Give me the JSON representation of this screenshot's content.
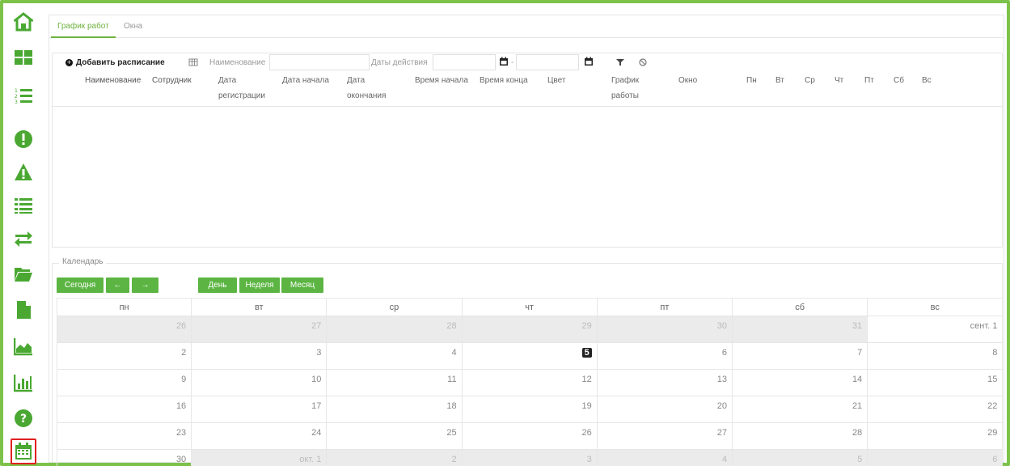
{
  "tabs": [
    {
      "label": "График работ"
    },
    {
      "label": "Окна"
    }
  ],
  "toolbar": {
    "add_label": "Добавить расписание",
    "name_label": "Наименование",
    "name_value": "",
    "dates_label": "Даты действия",
    "date_from": "",
    "date_to": "",
    "dash": "-"
  },
  "columns": [
    {
      "label": "Наименование"
    },
    {
      "label": "Сотрудник"
    },
    {
      "label": "Дата регистрации"
    },
    {
      "label": "Дата начала"
    },
    {
      "label": "Дата окончания"
    },
    {
      "label": "Время начала"
    },
    {
      "label": "Время конца"
    },
    {
      "label": "Цвет"
    },
    {
      "label": "График работы"
    },
    {
      "label": "Окно"
    },
    {
      "label": "Пн"
    },
    {
      "label": "Вт"
    },
    {
      "label": "Ср"
    },
    {
      "label": "Чт"
    },
    {
      "label": "Пт"
    },
    {
      "label": "Сб"
    },
    {
      "label": "Вс"
    }
  ],
  "calendar": {
    "legend": "Календарь",
    "today_btn": "Сегодня",
    "prev_btn": "←",
    "next_btn": "→",
    "day_btn": "День",
    "week_btn": "Неделя",
    "month_btn": "Месяц",
    "weekdays": [
      "пн",
      "вт",
      "ср",
      "чт",
      "пт",
      "сб",
      "вс"
    ],
    "weeks": [
      [
        "26",
        "27",
        "28",
        "29",
        "30",
        "31",
        "сент. 1"
      ],
      [
        "2",
        "3",
        "4",
        "5",
        "6",
        "7",
        "8"
      ],
      [
        "9",
        "10",
        "11",
        "12",
        "13",
        "14",
        "15"
      ],
      [
        "16",
        "17",
        "18",
        "19",
        "20",
        "21",
        "22"
      ],
      [
        "23",
        "24",
        "25",
        "26",
        "27",
        "28",
        "29"
      ],
      [
        "30",
        "окт. 1",
        "2",
        "3",
        "4",
        "5",
        "6"
      ]
    ],
    "today": "5"
  },
  "colors": {
    "accent": "#5cb543",
    "sidebar_icon": "#4aa832",
    "active_outline": "#e02020"
  },
  "sidebar": [
    {
      "icon": "home-icon"
    },
    {
      "icon": "dashboard-icon"
    },
    {
      "icon": "numbered-list-icon"
    },
    {
      "icon": "exclamation-icon"
    },
    {
      "icon": "warning-icon"
    },
    {
      "icon": "list-icon"
    },
    {
      "icon": "transfer-icon"
    },
    {
      "icon": "folder-icon"
    },
    {
      "icon": "document-icon"
    },
    {
      "icon": "area-chart-icon"
    },
    {
      "icon": "bar-chart-icon"
    },
    {
      "icon": "help-icon"
    },
    {
      "icon": "calendar-icon"
    }
  ]
}
